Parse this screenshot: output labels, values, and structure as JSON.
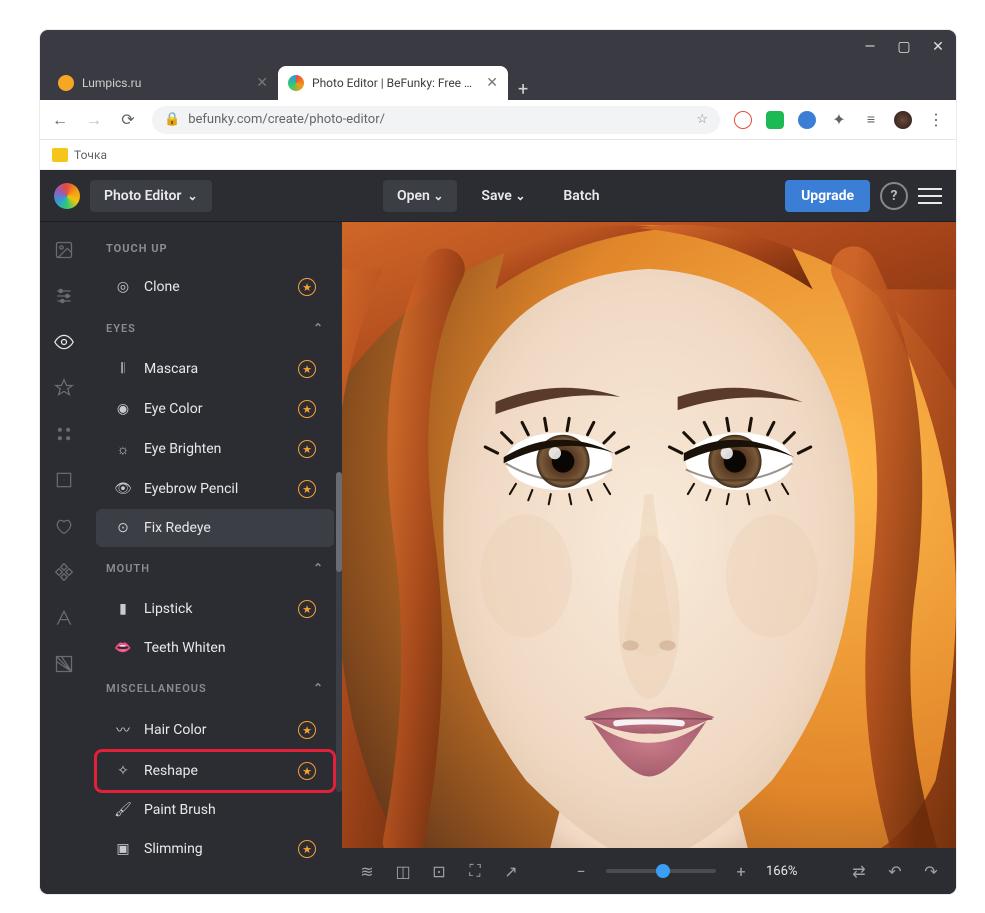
{
  "window": {
    "tabs": [
      {
        "label": "Lumpics.ru",
        "active": false,
        "favicon_color": "#f5a623"
      },
      {
        "label": "Photo Editor | BeFunky: Free Onli",
        "active": true,
        "favicon_color": "#e74c3c"
      }
    ]
  },
  "browser": {
    "url": "befunky.com/create/photo-editor/",
    "bookmark": "Точка",
    "bookmark_icon_color": "#f5c518"
  },
  "header": {
    "mode": "Photo Editor",
    "open": "Open",
    "save": "Save",
    "batch": "Batch",
    "upgrade": "Upgrade"
  },
  "sidebar": {
    "title": "TOUCH UP",
    "items": [
      {
        "icon": "clone",
        "label": "Clone",
        "premium": true
      },
      {
        "icon": "mascara",
        "label": "Mascara",
        "premium": true
      },
      {
        "icon": "eye-color",
        "label": "Eye Color",
        "premium": true
      },
      {
        "icon": "eye-brighten",
        "label": "Eye Brighten",
        "premium": true
      },
      {
        "icon": "eyebrow",
        "label": "Eyebrow Pencil",
        "premium": true
      },
      {
        "icon": "redeye",
        "label": "Fix Redeye",
        "premium": false,
        "selected": true
      },
      {
        "icon": "lipstick",
        "label": "Lipstick",
        "premium": true
      },
      {
        "icon": "teeth",
        "label": "Teeth Whiten",
        "premium": false
      },
      {
        "icon": "hair",
        "label": "Hair Color",
        "premium": true
      },
      {
        "icon": "reshape",
        "label": "Reshape",
        "premium": true,
        "highlight": true
      },
      {
        "icon": "brush",
        "label": "Paint Brush",
        "premium": false
      },
      {
        "icon": "slimming",
        "label": "Slimming",
        "premium": true
      }
    ],
    "sections": {
      "eyes": "EYES",
      "mouth": "MOUTH",
      "misc": "MISCELLANEOUS"
    }
  },
  "toolbar": {
    "zoom_percent": "166%"
  }
}
